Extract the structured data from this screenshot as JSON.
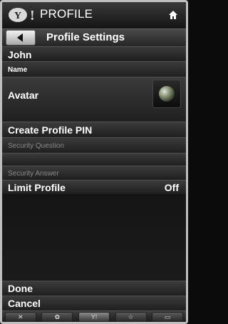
{
  "header": {
    "title": "PROFILE",
    "logo": "yahoo-y-logo",
    "home_icon": "home-icon"
  },
  "subheader": {
    "back_icon": "back-arrow-icon",
    "title": "Profile Settings"
  },
  "fields": {
    "name_value": "John",
    "name_label": "Name",
    "avatar_label": "Avatar",
    "create_pin_label": "Create Profile PIN",
    "security_question_label": "Security Question",
    "security_answer_label": "Security Answer",
    "limit_profile_label": "Limit Profile",
    "limit_profile_value": "Off"
  },
  "actions": {
    "done_label": "Done",
    "cancel_label": "Cancel"
  },
  "bottom_bar": {
    "close_glyph": "✕",
    "settings_glyph": "✿",
    "yahoo_glyph": "Y!",
    "star_glyph": "☆",
    "screen_glyph": "▭"
  },
  "colors": {
    "background": "#141414",
    "text": "#ffffff",
    "dim_text": "#8a8a8a",
    "border": "#bfbfbf"
  }
}
